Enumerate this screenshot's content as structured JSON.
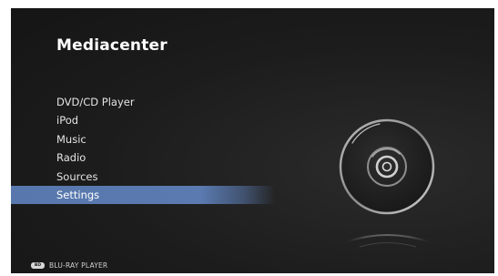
{
  "app": {
    "title": "Mediacenter"
  },
  "menu": {
    "items": [
      {
        "label": "DVD/CD Player",
        "selected": false
      },
      {
        "label": "iPod",
        "selected": false
      },
      {
        "label": "Music",
        "selected": false
      },
      {
        "label": "Radio",
        "selected": false
      },
      {
        "label": "Sources",
        "selected": false
      },
      {
        "label": "Settings",
        "selected": true
      }
    ]
  },
  "artwork": {
    "icon": "disc-icon"
  },
  "footer": {
    "logo_text": "BD",
    "label": "BLU-RAY PLAYER"
  },
  "colors": {
    "background": "#1c1c1c",
    "selection": "#5a7ab0",
    "text": "#e4e4e4"
  }
}
